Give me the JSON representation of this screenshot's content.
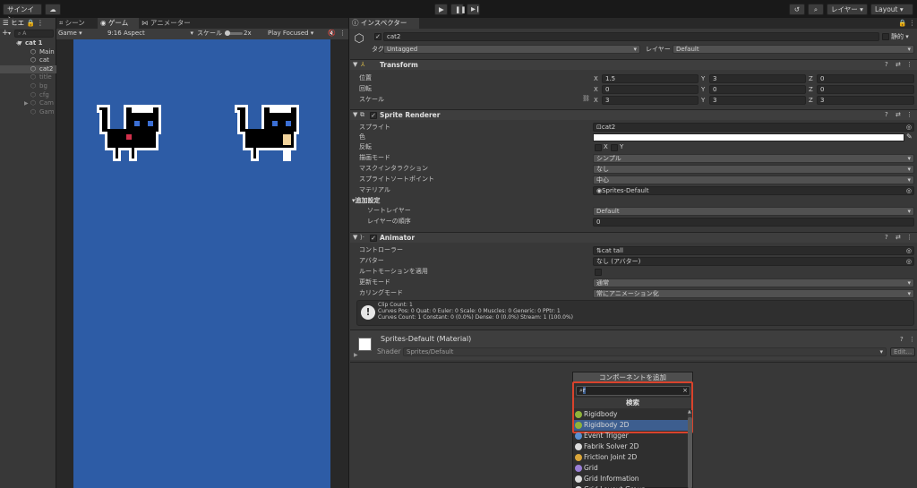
{
  "toolbar": {
    "signin": "サインイン",
    "layers": "レイヤー",
    "layout": "Layout"
  },
  "hierarchy": {
    "tab": "ヒエ",
    "search_placeholder": "A",
    "items": [
      {
        "label": "cat 1",
        "indent": 0,
        "bold": true,
        "selected": false
      },
      {
        "label": "Main",
        "indent": 1,
        "bold": false,
        "selected": false
      },
      {
        "label": "cat",
        "indent": 1,
        "bold": false,
        "selected": false
      },
      {
        "label": "cat2",
        "indent": 1,
        "bold": false,
        "selected": true
      },
      {
        "label": "title",
        "indent": 1,
        "bold": false,
        "selected": false,
        "dim": true
      },
      {
        "label": "bg",
        "indent": 1,
        "bold": false,
        "selected": false,
        "dim": true
      },
      {
        "label": "cfg",
        "indent": 1,
        "bold": false,
        "selected": false,
        "dim": true
      },
      {
        "label": "Cam",
        "indent": 1,
        "bold": false,
        "selected": false,
        "dim": true
      },
      {
        "label": "Gam",
        "indent": 1,
        "bold": false,
        "selected": false,
        "dim": true
      }
    ]
  },
  "game_view": {
    "tabs": [
      "シーン",
      "ゲーム",
      "アニメーター"
    ],
    "display": "Game",
    "aspect": "9:16 Aspect",
    "scale_label": "スケール",
    "scale_value": "2x",
    "play_mode": "Play Focused"
  },
  "inspector": {
    "tab": "インスペクター",
    "object_name": "cat2",
    "static_label": "静的",
    "tag_label": "タグ",
    "tag_value": "Untagged",
    "layer_label": "レイヤー",
    "layer_value": "Default",
    "transform": {
      "title": "Transform",
      "rows": [
        {
          "label": "位置",
          "x": "1.5",
          "y": "3",
          "z": "0"
        },
        {
          "label": "回転",
          "x": "0",
          "y": "0",
          "z": "0"
        },
        {
          "label": "スケール",
          "x": "3",
          "y": "3",
          "z": "3"
        }
      ]
    },
    "sprite_renderer": {
      "title": "Sprite Renderer",
      "sprite_label": "スプライト",
      "sprite_value": "cat2",
      "color_label": "色",
      "flip_label": "反転",
      "flip_x": "X",
      "flip_y": "Y",
      "draw_mode_label": "描画モード",
      "draw_mode_value": "シンプル",
      "mask_label": "マスクインタラクション",
      "mask_value": "なし",
      "sort_point_label": "スプライトソートポイント",
      "sort_point_value": "中心",
      "material_label": "マテリアル",
      "material_value": "Sprites-Default",
      "additional_label": "追加設定",
      "sort_layer_label": "ソートレイヤー",
      "sort_layer_value": "Default",
      "order_label": "レイヤーの順序",
      "order_value": "0"
    },
    "animator": {
      "title": "Animator",
      "controller_label": "コントローラー",
      "controller_value": "cat tall",
      "avatar_label": "アバター",
      "avatar_value": "なし (アバター)",
      "root_motion_label": "ルートモーションを適用",
      "update_label": "更新モード",
      "update_value": "通常",
      "culling_label": "カリングモード",
      "culling_value": "常にアニメーション化",
      "info_line1": "Clip Count: 1",
      "info_line2": "Curves Pos: 0 Quat: 0 Euler: 0 Scale: 0 Muscles: 0 Generic: 0 PPtr: 1",
      "info_line3": "Curves Count: 1 Constant: 0 (0.0%) Dense: 0 (0.0%) Stream: 1 (100.0%)"
    },
    "material": {
      "title": "Sprites-Default (Material)",
      "shader_label": "Shader",
      "shader_value": "Sprites/Default",
      "edit_label": "Edit..."
    }
  },
  "add_component": {
    "title": "コンポーネントを追加",
    "search_value": "r",
    "header": "検索",
    "items": [
      {
        "label": "Rigidbody",
        "color": "#8fb33a",
        "selected": false
      },
      {
        "label": "Rigidbody 2D",
        "color": "#8fb33a",
        "selected": true
      },
      {
        "label": "Event Trigger",
        "color": "#5a8fd0",
        "selected": false
      },
      {
        "label": "Fabrik Solver 2D",
        "color": "#dcdcdc",
        "selected": false
      },
      {
        "label": "Friction Joint 2D",
        "color": "#d9a53a",
        "selected": false
      },
      {
        "label": "Grid",
        "color": "#9a7fd6",
        "selected": false
      },
      {
        "label": "Grid Information",
        "color": "#dcdcdc",
        "selected": false
      },
      {
        "label": "Grid Layout Group",
        "color": "#dcdcdc",
        "selected": false
      }
    ]
  },
  "colors": {
    "game_bg": "#2d5ca6",
    "selection": "#3d5e8f",
    "highlight_border": "#d9432c"
  }
}
